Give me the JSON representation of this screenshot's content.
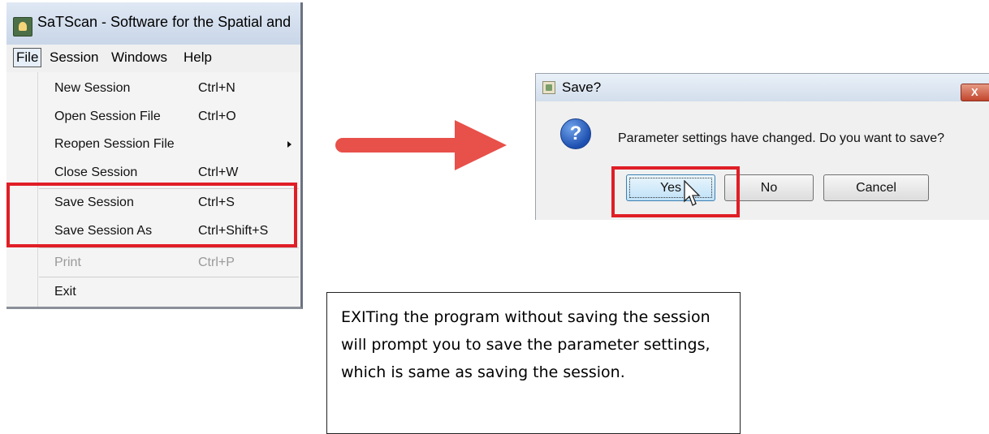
{
  "window": {
    "title": "SaTScan - Software for the Spatial and",
    "menubar": [
      "File",
      "Session",
      "Windows",
      "Help"
    ]
  },
  "file_menu": {
    "items": [
      {
        "label": "New Session",
        "shortcut": "Ctrl+N"
      },
      {
        "label": "Open Session File",
        "shortcut": "Ctrl+O"
      },
      {
        "label": "Reopen Session File",
        "shortcut": ""
      },
      {
        "label": "Close Session",
        "shortcut": "Ctrl+W"
      },
      {
        "label": "Save Session",
        "shortcut": "Ctrl+S"
      },
      {
        "label": "Save Session As",
        "shortcut": "Ctrl+Shift+S"
      },
      {
        "label": "Print",
        "shortcut": "Ctrl+P"
      },
      {
        "label": "Exit",
        "shortcut": ""
      }
    ]
  },
  "dialog": {
    "title": "Save?",
    "close_label": "X",
    "question_icon_glyph": "?",
    "message": "Parameter settings have changed. Do you want to save?",
    "buttons": {
      "yes": "Yes",
      "no": "No",
      "cancel": "Cancel"
    }
  },
  "note": {
    "text": "EXITing the program without saving the session will prompt you to save  the parameter settings, which is same as saving the session."
  },
  "colors": {
    "highlight": "#e01e26",
    "arrow": "#e8504a"
  }
}
